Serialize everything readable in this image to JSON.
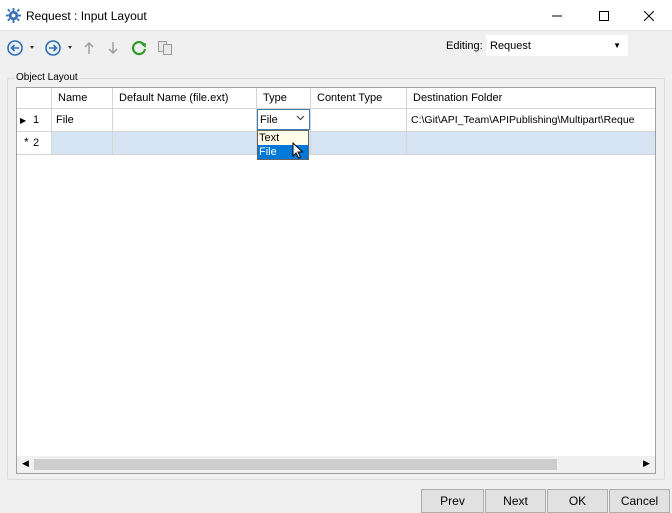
{
  "window": {
    "title": "Request : Input Layout",
    "min_glyph": "—",
    "max_glyph": "☐",
    "close_glyph": "✕"
  },
  "toolbar": {
    "items": [
      {
        "icon": "back-arrow-icon"
      },
      {
        "icon": "forward-arrow-icon"
      },
      {
        "icon": "move-up-icon"
      },
      {
        "icon": "move-down-icon"
      },
      {
        "icon": "refresh-icon"
      },
      {
        "icon": "copy-icon"
      }
    ],
    "editing_label": "Editing:",
    "editing_value": "Request"
  },
  "group": {
    "label": "Object Layout"
  },
  "grid": {
    "columns": [
      "Name",
      "Default Name (file.ext)",
      "Type",
      "Content Type",
      "Destination Folder"
    ],
    "rows": [
      {
        "indicator": "1",
        "name": "File",
        "default_name": "",
        "type": "File",
        "content_type": "",
        "destination": "C:\\Git\\API_Team\\APIPublishing\\Multipart\\Reque"
      },
      {
        "indicator": "2",
        "name": "",
        "default_name": "",
        "type": "",
        "content_type": "",
        "destination": ""
      }
    ],
    "type_options": [
      "Text",
      "File"
    ],
    "type_selected": "File"
  },
  "buttons": {
    "prev": "Prev",
    "next": "Next",
    "ok": "OK",
    "cancel": "Cancel"
  },
  "colors": {
    "selection": "#0078d7",
    "new_row": "#d5e3f3",
    "refresh": "#2e9a2e",
    "nav_blue": "#2d6fb6"
  }
}
